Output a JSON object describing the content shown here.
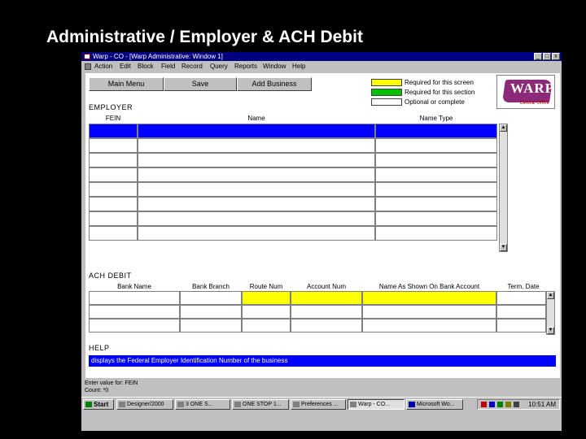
{
  "slide": {
    "title": "Administrative / Employer & ACH Debit"
  },
  "window": {
    "title": "Warp - CO - [Warp Administrative: Window 1]",
    "controls": [
      "_",
      "□",
      "x"
    ]
  },
  "menu": [
    "Action",
    "Edit",
    "Block",
    "Field",
    "Record",
    "Query",
    "Reports",
    "Window",
    "Help"
  ],
  "toolbar": {
    "main_menu": "Main Menu",
    "save": "Save",
    "add_business": "Add Business"
  },
  "legend": {
    "items": [
      {
        "label": "Required for this screen",
        "color": "#ffff00"
      },
      {
        "label": "Required for this section",
        "color": "#00c000"
      },
      {
        "label": "Optional or complete",
        "color": "#ffffff"
      }
    ]
  },
  "logo": {
    "text": "WARP",
    "subtitle": "Central Office"
  },
  "employer": {
    "section_label": "EMPLOYER",
    "columns": [
      "FEIN",
      "Name",
      "Name Type"
    ]
  },
  "ach": {
    "section_label": "ACH DEBIT",
    "columns": [
      "Bank Name",
      "Bank Branch",
      "Route Num",
      "Account Num",
      "Name As Shown On Bank Account",
      "Term. Date"
    ]
  },
  "help": {
    "section_label": "HELP",
    "text": "displays the Federal Employer Identification Number of the business"
  },
  "status": {
    "line1": "Enter value for: FEIN",
    "line2": "Count: *0"
  },
  "taskbar": {
    "start": "Start",
    "tasks": [
      "Designer/2000",
      "3 ONE S...",
      "ONE STOP 1...",
      "Preferences ...",
      "Warp - CO...",
      "Microsoft Wo..."
    ],
    "clock": "10:51 AM"
  },
  "colors": {
    "selection": "#0000ff",
    "required_screen": "#ffff00",
    "titlebar": "#000080"
  }
}
